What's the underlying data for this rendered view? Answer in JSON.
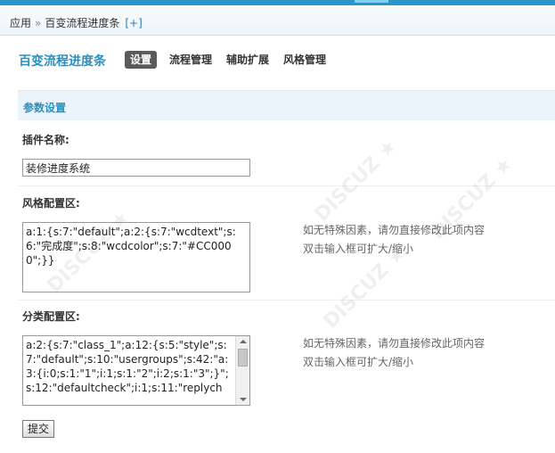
{
  "breadcrumb": {
    "app": "应用",
    "separator": "»",
    "current": "百变流程进度条",
    "add": "[+]"
  },
  "header": {
    "plugin_title": "百变流程进度条",
    "tabs": [
      {
        "label": "设置",
        "active": true
      },
      {
        "label": "流程管理",
        "active": false
      },
      {
        "label": "辅助扩展",
        "active": false
      },
      {
        "label": "风格管理",
        "active": false
      }
    ]
  },
  "section": {
    "title": "参数设置"
  },
  "fields": {
    "plugin_name": {
      "label": "插件名称:",
      "value": "装修进度系统"
    },
    "style_config": {
      "label": "风格配置区:",
      "value": "a:1:{s:7:\"default\";a:2:{s:7:\"wcdtext\";s:6:\"完成度\";s:8:\"wcdcolor\";s:7:\"#CC0000\";}}",
      "hint_line1": "如无特殊因素，请勿直接修改此项内容",
      "hint_line2": "双击输入框可扩大/缩小"
    },
    "category_config": {
      "label": "分类配置区:",
      "value": "a:2:{s:7:\"class_1\";a:12:{s:5:\"style\";s:7:\"default\";s:10:\"usergroups\";s:42:\"a:3:{i:0;s:1:\"1\";i:1;s:1:\"2\";i:2;s:1:\"3\";}\";s:12:\"defaultcheck\";i:1;s:11:\"replych",
      "hint_line1": "如无特殊因素，请勿直接修改此项内容",
      "hint_line2": "双击输入框可扩大/缩小"
    }
  },
  "actions": {
    "submit_label": "提交"
  },
  "colors": {
    "top_bar": "#2b94c8",
    "accent_text": "#2b8fbf",
    "section_bg": "#eaf4fa",
    "active_tab_bg": "#5b5b5b"
  }
}
